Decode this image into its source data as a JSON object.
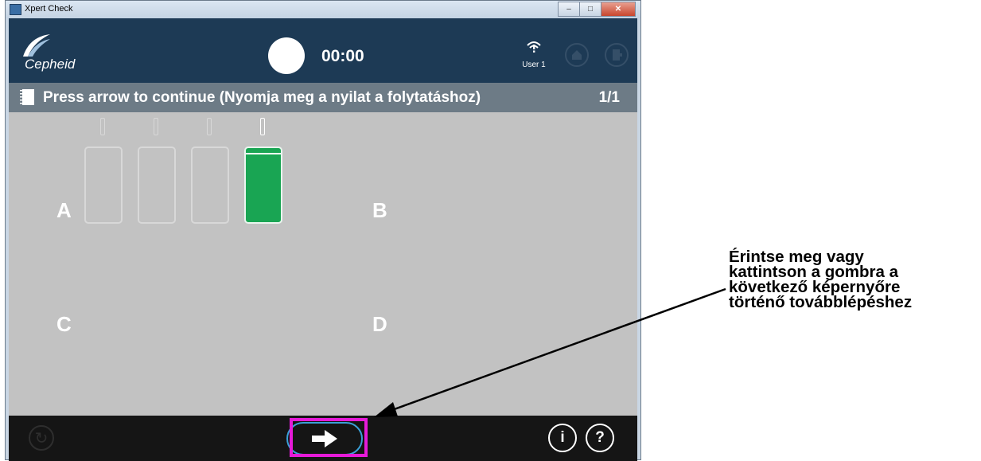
{
  "window": {
    "title": "Xpert Check",
    "minimize_label": "–",
    "maximize_label": "□",
    "close_label": "✕"
  },
  "header": {
    "brand": "Cepheid",
    "timer": "00:00",
    "user_label": "User 1"
  },
  "instruction_bar": {
    "text": "Press arrow to continue (Nyomja meg a nyilat a folytatáshoz)",
    "page": "1/1"
  },
  "modules": {
    "label_a": "A",
    "label_b": "B",
    "label_c": "C",
    "label_d": "D",
    "bays": [
      {
        "state": "empty"
      },
      {
        "state": "empty"
      },
      {
        "state": "empty"
      },
      {
        "state": "active"
      }
    ]
  },
  "footer": {
    "refresh_icon": "↻",
    "info_label": "i",
    "help_label": "?"
  },
  "callout": {
    "lines": [
      "Érintse meg vagy",
      "kattintson a gombra a",
      "következő képernyőre",
      "történő továbblépéshez"
    ]
  },
  "colors": {
    "header_bg": "#1d3a55",
    "instruction_bg": "#6d7b86",
    "active_module": "#19a553",
    "highlight": "#e61ad8",
    "next_button_border": "#3aa0d8"
  }
}
